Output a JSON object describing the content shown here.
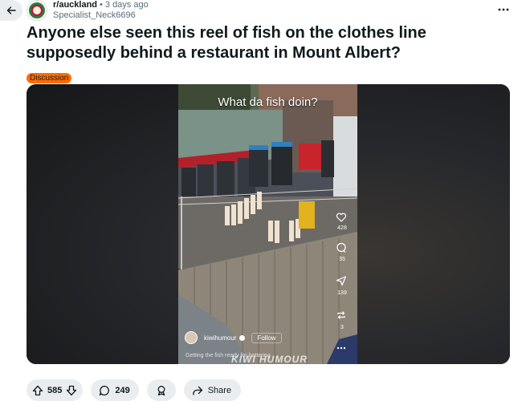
{
  "header": {
    "subreddit": "r/auckland",
    "separator": "•",
    "time_ago": "3 days ago",
    "author": "Specialist_Neck6696",
    "back_icon": "arrow-left-icon",
    "more_icon": "more-horizontal-icon"
  },
  "post": {
    "title": "Anyone else seen this reel of fish on the clothes line supposedly behind a restaurant in Mount Albert?",
    "flair": "Discussion",
    "flair_color": "#ff6d00"
  },
  "video": {
    "caption": "What da fish doin?",
    "side_counts": {
      "likes": "428",
      "comments": "35",
      "shares": "139",
      "reposts": "3"
    },
    "creator": "kiwihumour",
    "follow_label": "Follow",
    "description": "Getting the fish ready for battering",
    "watermark": "KIWI HUMOUR"
  },
  "actions": {
    "score": "585",
    "comments": "249",
    "share_label": "Share",
    "bar_color": "#eaedef"
  }
}
